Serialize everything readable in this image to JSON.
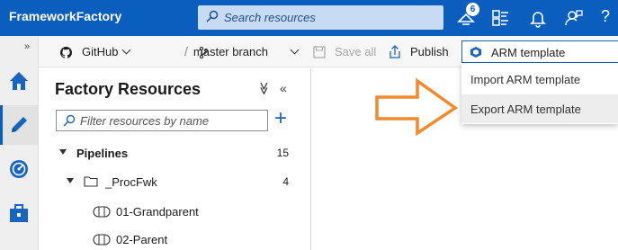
{
  "app": {
    "title": "FrameworkFactory"
  },
  "search": {
    "placeholder": "Search resources"
  },
  "topbar": {
    "notification_count": "6",
    "help_label": "?",
    "icons": [
      "notifications-icon",
      "directory-icon",
      "bell-icon",
      "feedback-icon",
      "help-icon"
    ]
  },
  "rail": {
    "collapse_label": "»",
    "items": [
      {
        "name": "home",
        "icon": "home-icon"
      },
      {
        "name": "author",
        "icon": "pencil-icon",
        "active": true
      },
      {
        "name": "monitor",
        "icon": "gauge-icon"
      },
      {
        "name": "manage",
        "icon": "toolbox-icon"
      }
    ]
  },
  "toolbar": {
    "repo_label": "GitHub",
    "separator": "/",
    "branch_label": "master branch",
    "save_all_label": "Save all",
    "publish_label": "Publish",
    "arm_label": "ARM template"
  },
  "arm_menu": {
    "items": [
      {
        "label": "Import ARM template"
      },
      {
        "label": "Export ARM template",
        "hovered": true
      }
    ]
  },
  "factory_resources": {
    "title": "Factory Resources",
    "collapse_all": "≫",
    "hide_pane": "«",
    "filter_placeholder": "Filter resources by name",
    "add_label": "+",
    "tree": {
      "pipelines_label": "Pipelines",
      "pipelines_count": "15",
      "folder_label": "_ProcFwk",
      "folder_count": "4",
      "items": [
        "01-Grandparent",
        "02-Parent"
      ]
    }
  },
  "colors": {
    "accent": "#0a5ebd",
    "annotation_arrow": "#f08a2a"
  }
}
